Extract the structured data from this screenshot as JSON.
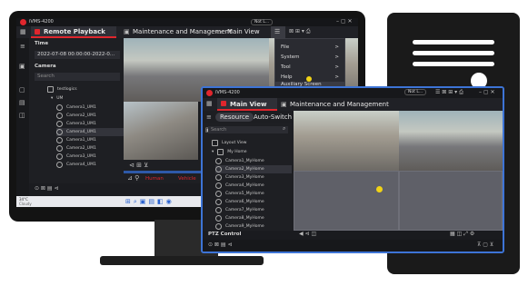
{
  "colors": {
    "accent": "#e0262d",
    "blue_frame": "#3d74d6",
    "yellow_dot": "#f1d316"
  },
  "back": {
    "app_name": "iVMS-4200",
    "tabs": [
      "Remote Playback",
      "Maintenance and Management",
      "Main View"
    ],
    "user_label": "Not L...",
    "time_title": "Time",
    "time_value": "2022-07-08 00:00:00-2022-0...",
    "camera_title": "Camera",
    "search_placeholder": "Search",
    "tree_root": "testlogics",
    "tree_group": "UM",
    "cameras": [
      "Camera1_UM1",
      "Camera2_UM1",
      "Camera3_UM1",
      "Camera4_UM1",
      "Camera1_UM1",
      "Camera2_UM1",
      "Camera3_UM1",
      "Camera4_UM1"
    ],
    "menu": [
      {
        "label": "File",
        "arrow": ">"
      },
      {
        "label": "System",
        "arrow": ">"
      },
      {
        "label": "Tool",
        "arrow": ">"
      },
      {
        "label": "Help",
        "arrow": ">"
      },
      {
        "label": "Auxiliary Screen Preview",
        "arrow": ""
      }
    ],
    "filter_labels": [
      "Human",
      "Vehicle"
    ],
    "taskbar_weather": "34°C",
    "taskbar_sub": "Cloudy"
  },
  "front": {
    "app_name": "iVMS-4200",
    "user_label": "Not L...",
    "tabs": [
      "Main View",
      "Maintenance and Management"
    ],
    "subtabs": [
      "Resource",
      "Auto-Switch"
    ],
    "search_placeholder": "Search",
    "tree_root": "Layout View",
    "tree_group": "My Home",
    "cameras": [
      "Camera1_MyHome",
      "Camera2_MyHome",
      "Camera3_MyHome",
      "Camera4_MyHome",
      "Camera5_MyHome",
      "Camera6_MyHome",
      "Camera7_MyHome",
      "Camera8_MyHome",
      "Camera9_MyHome"
    ],
    "ptz_label": "PTZ Control"
  }
}
